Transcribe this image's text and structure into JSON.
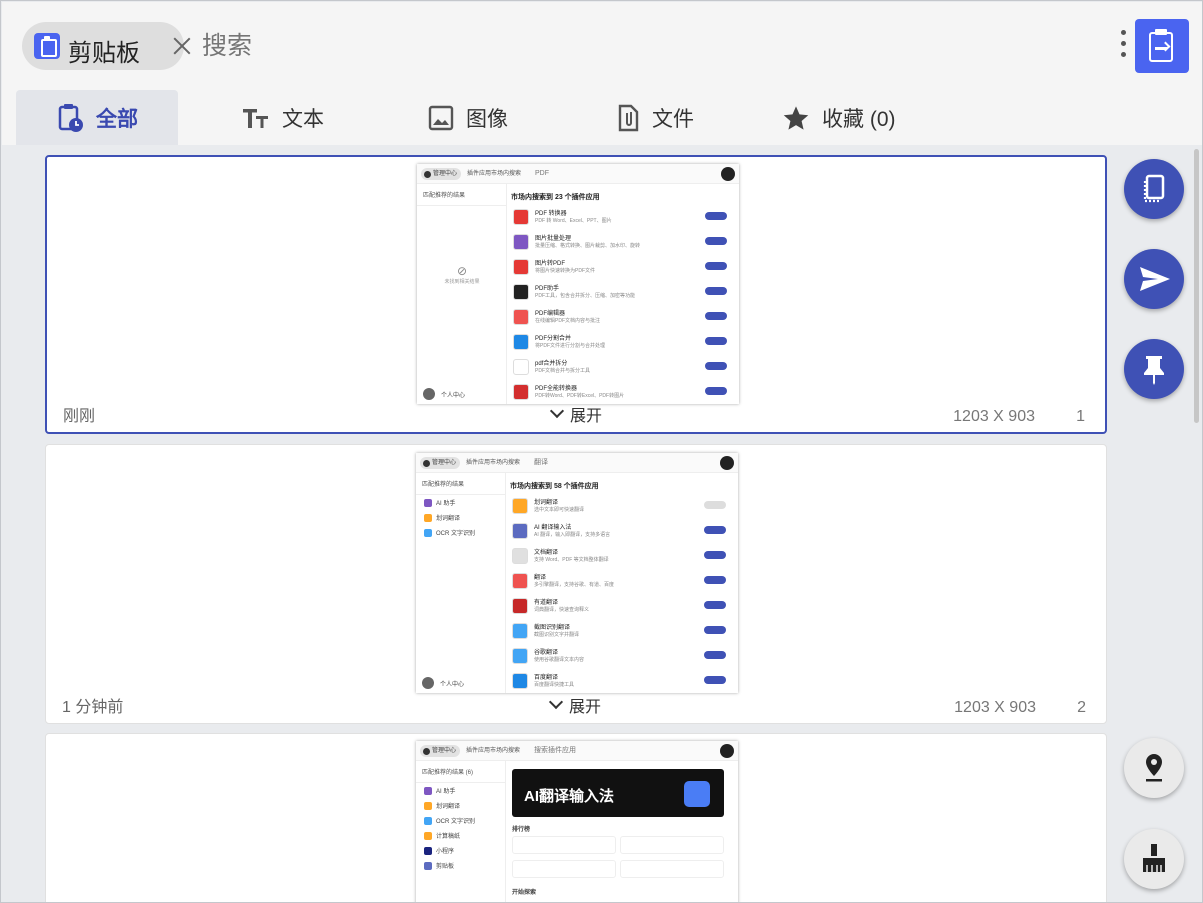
{
  "header": {
    "chip_label": "剪贴板",
    "search_placeholder": "搜索"
  },
  "tabs": [
    {
      "label": "全部"
    },
    {
      "label": "文本"
    },
    {
      "label": "图像"
    },
    {
      "label": "文件"
    },
    {
      "label": "收藏 (0)"
    }
  ],
  "cards": [
    {
      "time": "刚刚",
      "expand": "展开",
      "dims": "1203 X 903",
      "index": "1",
      "thumb": {
        "chip": "管理中心",
        "tab": "插件应用市场内搜索",
        "query": "PDF",
        "side_header": "匹配推荐的结果",
        "empty": "未找到相关结果",
        "user": "个人中心",
        "head": "市场内搜索到 23 个插件应用",
        "rows": [
          {
            "t": "PDF 转换器",
            "d": "PDF 转 Word、Excel、PPT、图片"
          },
          {
            "t": "图片批量处理",
            "d": "批量压缩、格式转换、图片裁剪、加水印、旋转"
          },
          {
            "t": "图片转PDF",
            "d": "将图片快速转换为PDF文件"
          },
          {
            "t": "PDF助手",
            "d": "PDF工具，包含合并拆分、压缩、加密等功能"
          },
          {
            "t": "PDF编辑器",
            "d": "在线编辑PDF文档内容与批注"
          },
          {
            "t": "PDF分割合并",
            "d": "将PDF文件进行分割与合并处理"
          },
          {
            "t": "pdf合并拆分",
            "d": "PDF文档合并与拆分工具"
          },
          {
            "t": "PDF全能转换器",
            "d": "PDF转Word、PDF转Excel、PDF转图片"
          }
        ]
      }
    },
    {
      "time": "1 分钟前",
      "expand": "展开",
      "dims": "1203 X 903",
      "index": "2",
      "thumb": {
        "chip": "管理中心",
        "tab": "插件应用市场内搜索",
        "query": "翻译",
        "side_header": "匹配推荐的结果",
        "side": [
          "AI 助手",
          "划词翻译",
          "OCR 文字识别"
        ],
        "user": "个人中心",
        "head": "市场内搜索到 58 个插件应用",
        "rows": [
          {
            "t": "划词翻译",
            "d": "选中文本即可快速翻译"
          },
          {
            "t": "AI 翻译输入法",
            "d": "AI 翻译，输入即翻译，支持多语言"
          },
          {
            "t": "文档翻译",
            "d": "支持 Word、PDF 等文档整体翻译"
          },
          {
            "t": "翻译",
            "d": "多引擎翻译，支持谷歌、有道、百度"
          },
          {
            "t": "有道翻译",
            "d": "词典翻译，快速查询释义"
          },
          {
            "t": "截图识别翻译",
            "d": "截图识别文字并翻译"
          },
          {
            "t": "谷歌翻译",
            "d": "使用谷歌翻译文本内容"
          },
          {
            "t": "百度翻译",
            "d": "百度翻译快捷工具"
          }
        ]
      }
    },
    {
      "time": "",
      "expand": "",
      "dims": "",
      "index": "",
      "thumb": {
        "chip": "管理中心",
        "tab": "插件应用市场内搜索",
        "query": "搜索插件应用",
        "side_header": "匹配推荐的结果 (6)",
        "side": [
          "AI 助手",
          "划词翻译",
          "OCR 文字识别",
          "计算稿纸",
          "小程序",
          "剪贴板"
        ],
        "banner": "AI翻译输入法",
        "rank": "排行榜",
        "recent": "开始探索"
      }
    }
  ]
}
